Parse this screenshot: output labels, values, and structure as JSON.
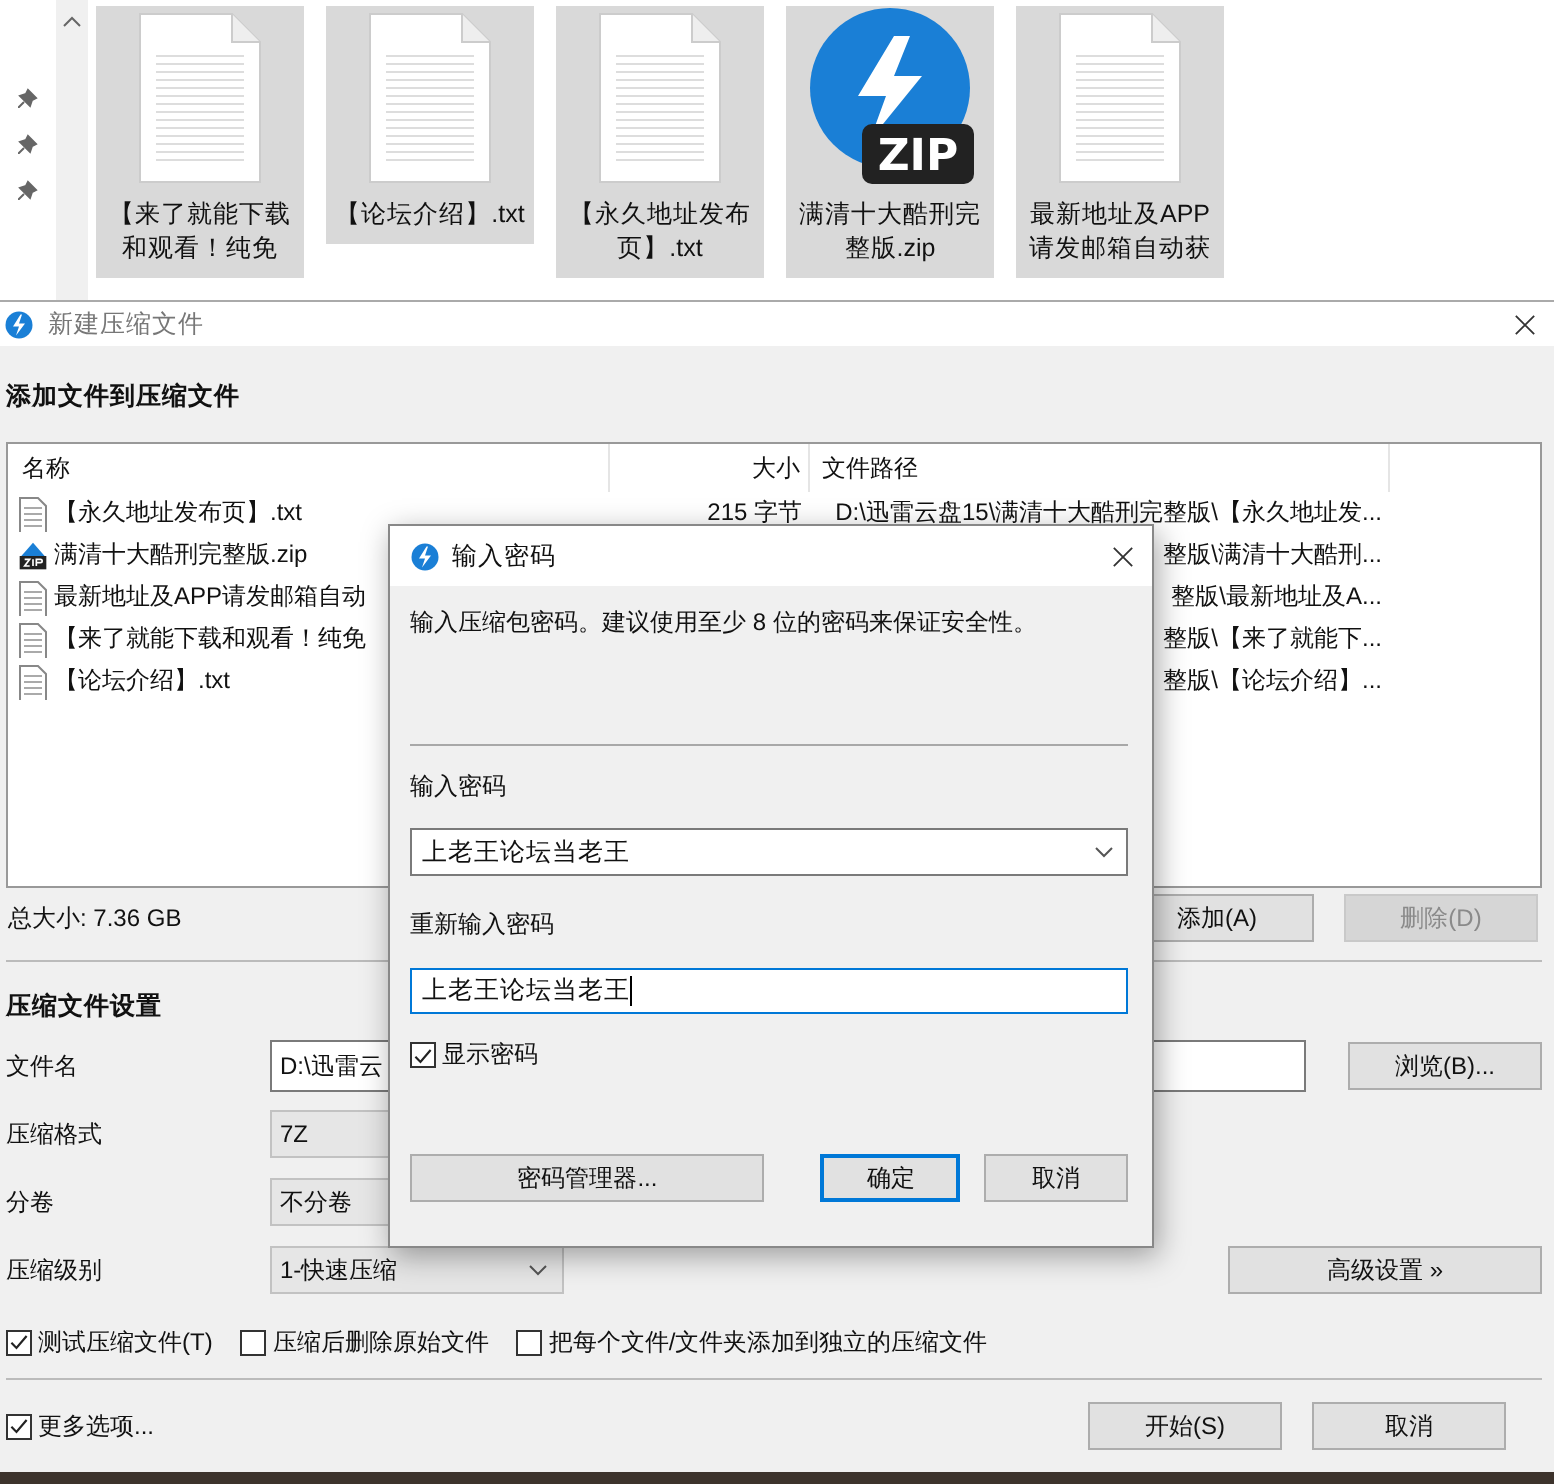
{
  "explorer": {
    "files": [
      {
        "kind": "txt",
        "label": "【来了就能下载和观看！纯免",
        "selected": true
      },
      {
        "kind": "txt",
        "label": "【论坛介绍】.txt",
        "selected": true
      },
      {
        "kind": "txt",
        "label": "【永久地址发布页】.txt",
        "selected": true
      },
      {
        "kind": "zip",
        "label": "满清十大酷刑完整版.zip",
        "icon_text": "ZIP",
        "selected": true
      },
      {
        "kind": "txt",
        "label": "最新地址及APP请发邮箱自动获",
        "selected": true
      }
    ]
  },
  "main_window": {
    "title": "新建压缩文件",
    "files_section": {
      "heading": "添加文件到压缩文件",
      "columns": [
        "名称",
        "大小",
        "文件路径"
      ],
      "rows": [
        {
          "kind": "txt",
          "name": "【永久地址发布页】.txt",
          "size": "215 字节",
          "path": "D:\\迅雷云盘15\\满清十大酷刑完整版\\【永久地址发..."
        },
        {
          "kind": "zip",
          "name": "满清十大酷刑完整版.zip",
          "path": "整版\\满清十大酷刑..."
        },
        {
          "kind": "txt",
          "name": "最新地址及APP请发邮箱自动",
          "path": "整版\\最新地址及A..."
        },
        {
          "kind": "txt",
          "name": "【来了就能下载和观看！纯免",
          "path": "整版\\【来了就能下..."
        },
        {
          "kind": "txt",
          "name": "【论坛介绍】.txt",
          "path": "整版\\【论坛介绍】..."
        }
      ],
      "total": "总大小: 7.36 GB",
      "buttons": [
        {
          "label": "添加(A)",
          "disabled": false
        },
        {
          "label": "删除(D)",
          "disabled": true
        }
      ]
    },
    "settings": {
      "heading": "压缩文件设置",
      "fields": [
        {
          "kind": "text",
          "label": "文件名",
          "value": "D:\\迅雷云",
          "button": "浏览(B)..."
        },
        {
          "kind": "box",
          "label": "压缩格式",
          "value": "7Z"
        },
        {
          "kind": "box",
          "label": "分卷",
          "value": "不分卷"
        },
        {
          "kind": "select",
          "label": "压缩级别",
          "value": "1-快速压缩",
          "button": "高级设置 »"
        }
      ],
      "options": [
        {
          "label": "测试压缩文件(T)",
          "checked": true
        },
        {
          "label": "压缩后删除原始文件",
          "checked": false
        },
        {
          "label": "把每个文件/文件夹添加到独立的压缩文件",
          "checked": false
        }
      ]
    },
    "more_options": {
      "label": "更多选项...",
      "checked": true
    },
    "buttons": [
      "开始(S)",
      "取消"
    ]
  },
  "password_dialog": {
    "title": "输入密码",
    "description": "输入压缩包密码。建议使用至少 8 位的密码来保证安全性。",
    "password_label": "输入密码",
    "password": "上老王论坛当老王",
    "confirm_label": "重新输入密码",
    "confirm": "上老王论坛当老王",
    "show_password": {
      "label": "显示密码",
      "checked": true
    },
    "buttons": [
      {
        "label": "密码管理器...",
        "default": false
      },
      {
        "label": "确定",
        "default": true
      },
      {
        "label": "取消",
        "default": false
      }
    ]
  }
}
